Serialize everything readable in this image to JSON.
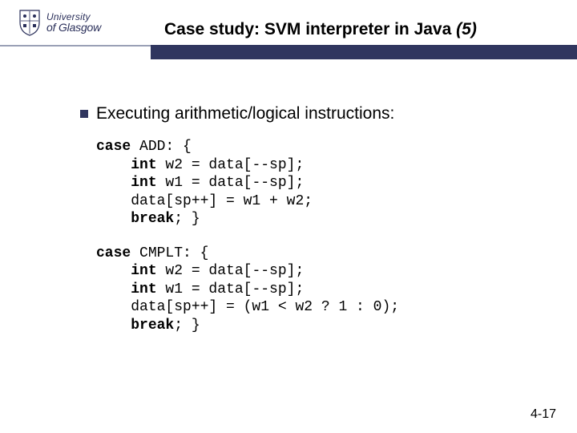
{
  "brand": {
    "line1": "University",
    "line2": "of Glasgow"
  },
  "title": {
    "prefix": "Case study: SVM interpreter in Java ",
    "suffix_italic": "(5)"
  },
  "bullet": "Executing arithmetic/logical instructions:",
  "code1": {
    "kw_case": "case",
    "case_name": " ADD: {",
    "l2a": "int",
    "l2b": " w2 = data[--sp];",
    "l3a": "int",
    "l3b": " w1 = data[--sp];",
    "l4": "    data[sp++] = w1 + w2;",
    "l5a": "break",
    "l5b": "; }"
  },
  "code2": {
    "kw_case": "case",
    "case_name": " CMPLT: {",
    "l2a": "int",
    "l2b": " w2 = data[--sp];",
    "l3a": "int",
    "l3b": " w1 = data[--sp];",
    "l4": "    data[sp++] = (w1 < w2 ? 1 : 0);",
    "l5a": "break",
    "l5b": "; }"
  },
  "slide_number": "4-17"
}
